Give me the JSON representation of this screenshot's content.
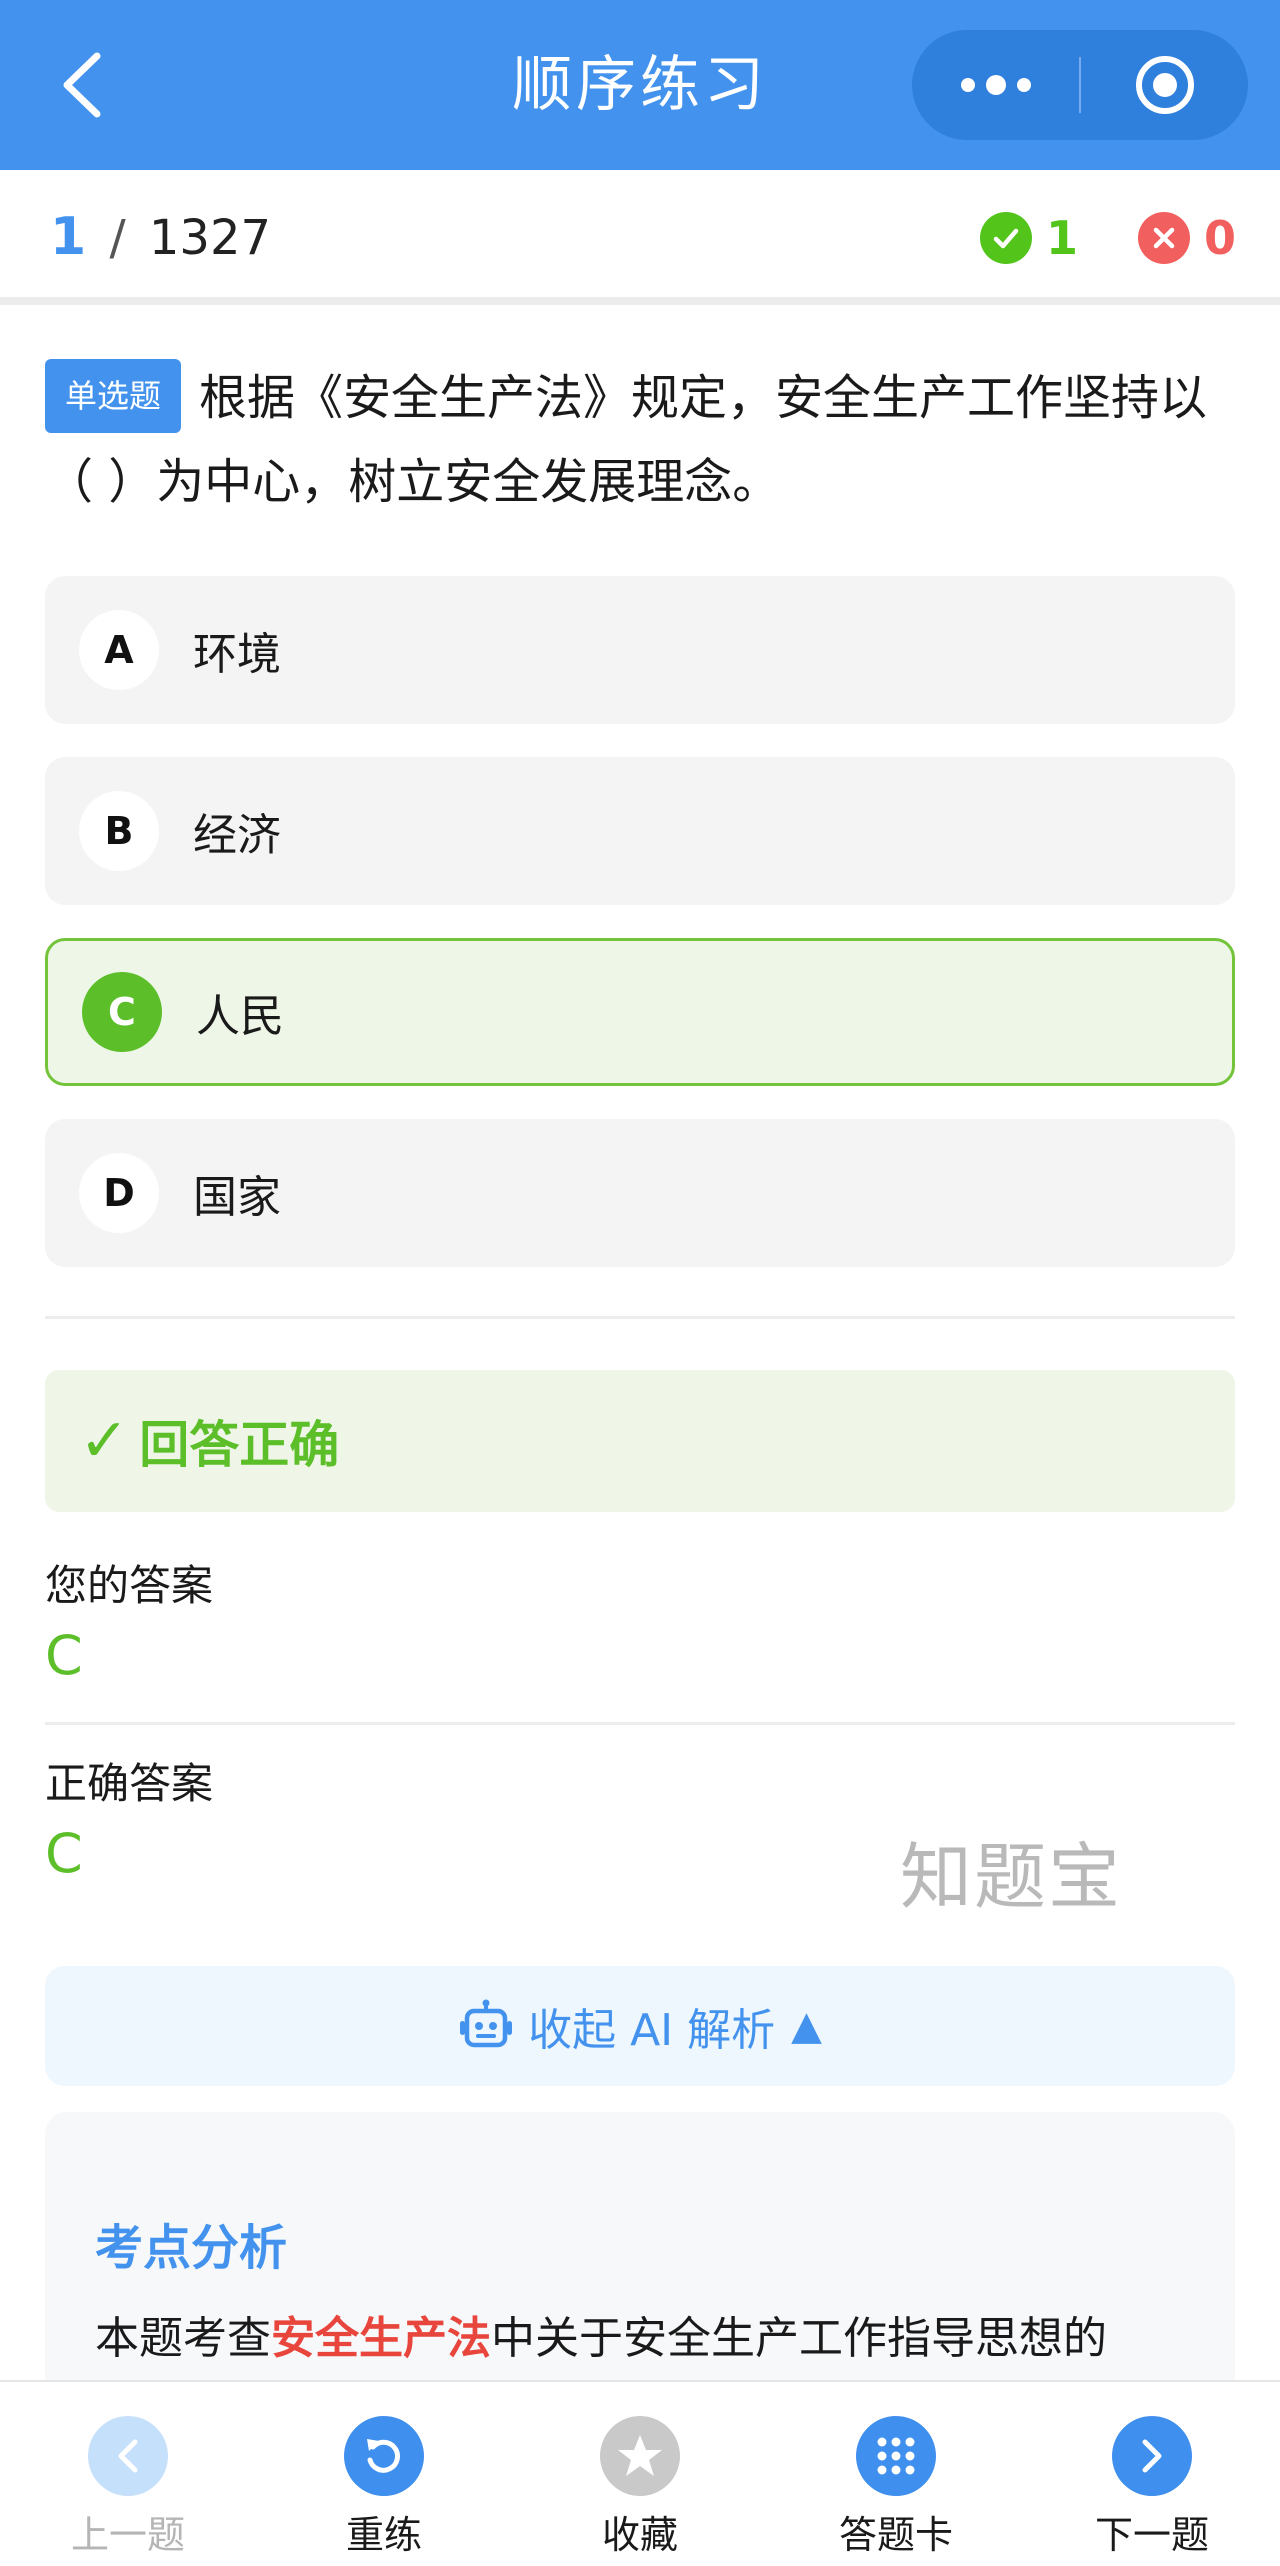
{
  "navbar": {
    "title": "顺序练习",
    "back_icon": "chevron-left-icon",
    "more_icon": "more-dots-icon",
    "close_icon": "target-circle-icon",
    "background_color": "#4393ee"
  },
  "progress": {
    "current": "1",
    "separator": "/",
    "total": "1327",
    "correct_count": "1",
    "wrong_count": "0"
  },
  "question": {
    "type": "单选题",
    "text": "根据《安全生产法》规定，安全生产工作坚持以（ ）为中心，树立安全发展理念。"
  },
  "options": [
    {
      "letter": "A",
      "text": "环境",
      "state": "normal"
    },
    {
      "letter": "B",
      "text": "经济",
      "state": "normal"
    },
    {
      "letter": "C",
      "text": "人民",
      "state": "correct"
    },
    {
      "letter": "D",
      "text": "国家",
      "state": "normal"
    }
  ],
  "result": {
    "check": "✓",
    "message": "回答正确",
    "your_answer_label": "您的答案",
    "your_answer": "C",
    "correct_answer_label": "正确答案",
    "correct_answer": "C",
    "color": "#5cbf2a"
  },
  "watermark": "知题宝",
  "ai": {
    "toggle_label": "收起 AI 解析",
    "toggle_arrow": "▲",
    "icon": "robot-icon"
  },
  "analysis": {
    "title": "考点分析",
    "text_before": "本题考查",
    "highlight": "安全生产法",
    "text_after": "中关于安全生产工作指导思想的"
  },
  "tabbar": {
    "prev": {
      "label": "上一题",
      "icon": "chevron-left-icon"
    },
    "retry": {
      "label": "重练",
      "icon": "refresh-icon"
    },
    "favorite": {
      "label": "收藏",
      "icon": "star-icon"
    },
    "answer_card": {
      "label": "答题卡",
      "icon": "grid-icon"
    },
    "next": {
      "label": "下一题",
      "icon": "chevron-right-icon"
    }
  }
}
